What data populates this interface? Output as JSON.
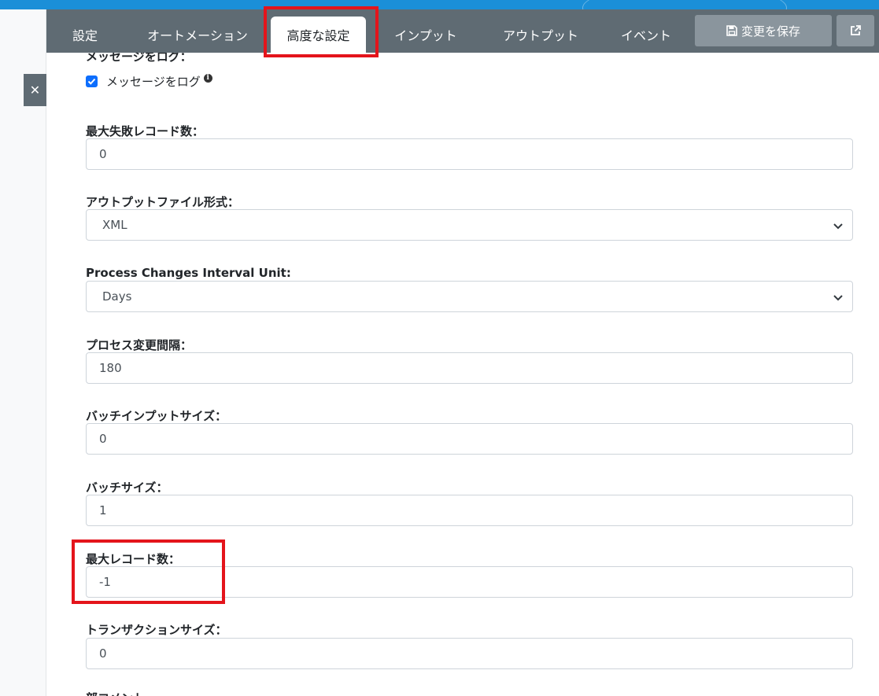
{
  "tabs": [
    {
      "label": "設定"
    },
    {
      "label": "オートメーション"
    },
    {
      "label": "高度な設定"
    },
    {
      "label": "インプット"
    },
    {
      "label": "アウトプット"
    },
    {
      "label": "イベント"
    }
  ],
  "toolbar": {
    "save_label": "変更を保存",
    "save_icon": "floppy-disk-icon",
    "external_icon": "external-link-icon",
    "close_icon": "close-icon",
    "close_glyph": "✕"
  },
  "form": {
    "log_messages": {
      "label": "メッセージをログ：",
      "checkbox_label": "メッセージをログ",
      "checked": true,
      "info_glyph": "i"
    },
    "max_failed_records": {
      "label": "最大失敗レコード数：",
      "value": "0"
    },
    "output_file_format": {
      "label": "アウトプットファイル形式：",
      "value": "XML"
    },
    "process_changes_interval_unit": {
      "label": "Process Changes Interval Unit:",
      "value": "Days"
    },
    "process_changes_interval": {
      "label": "プロセス変更間隔：",
      "value": "180"
    },
    "batch_input_size": {
      "label": "バッチインプットサイズ：",
      "value": "0"
    },
    "batch_size": {
      "label": "バッチサイズ：",
      "value": "1"
    },
    "max_records": {
      "label": "最大レコード数：",
      "value": "-1"
    },
    "transaction_size": {
      "label": "トランザクションサイズ：",
      "value": "0"
    },
    "partial_label": "部コメント"
  },
  "colors": {
    "tabbar": "#5f6b73",
    "highlight": "#e4141b",
    "checkbox": "#0d6efd",
    "topstrip": "#1b8fd8"
  }
}
